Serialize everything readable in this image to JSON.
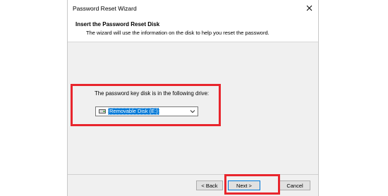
{
  "window": {
    "title": "Password Reset Wizard",
    "close_label": "×"
  },
  "header": {
    "title": "Insert the Password Reset Disk",
    "description": "The wizard will use the information on the disk to help you reset the password."
  },
  "drive": {
    "label": "The password key disk is in the following drive:",
    "selected": "Removable Disk (E:)"
  },
  "buttons": {
    "back": "< Back",
    "next": "Next >",
    "cancel": "Cancel"
  },
  "colors": {
    "highlight": "#e8262d",
    "selection": "#0078d7"
  }
}
